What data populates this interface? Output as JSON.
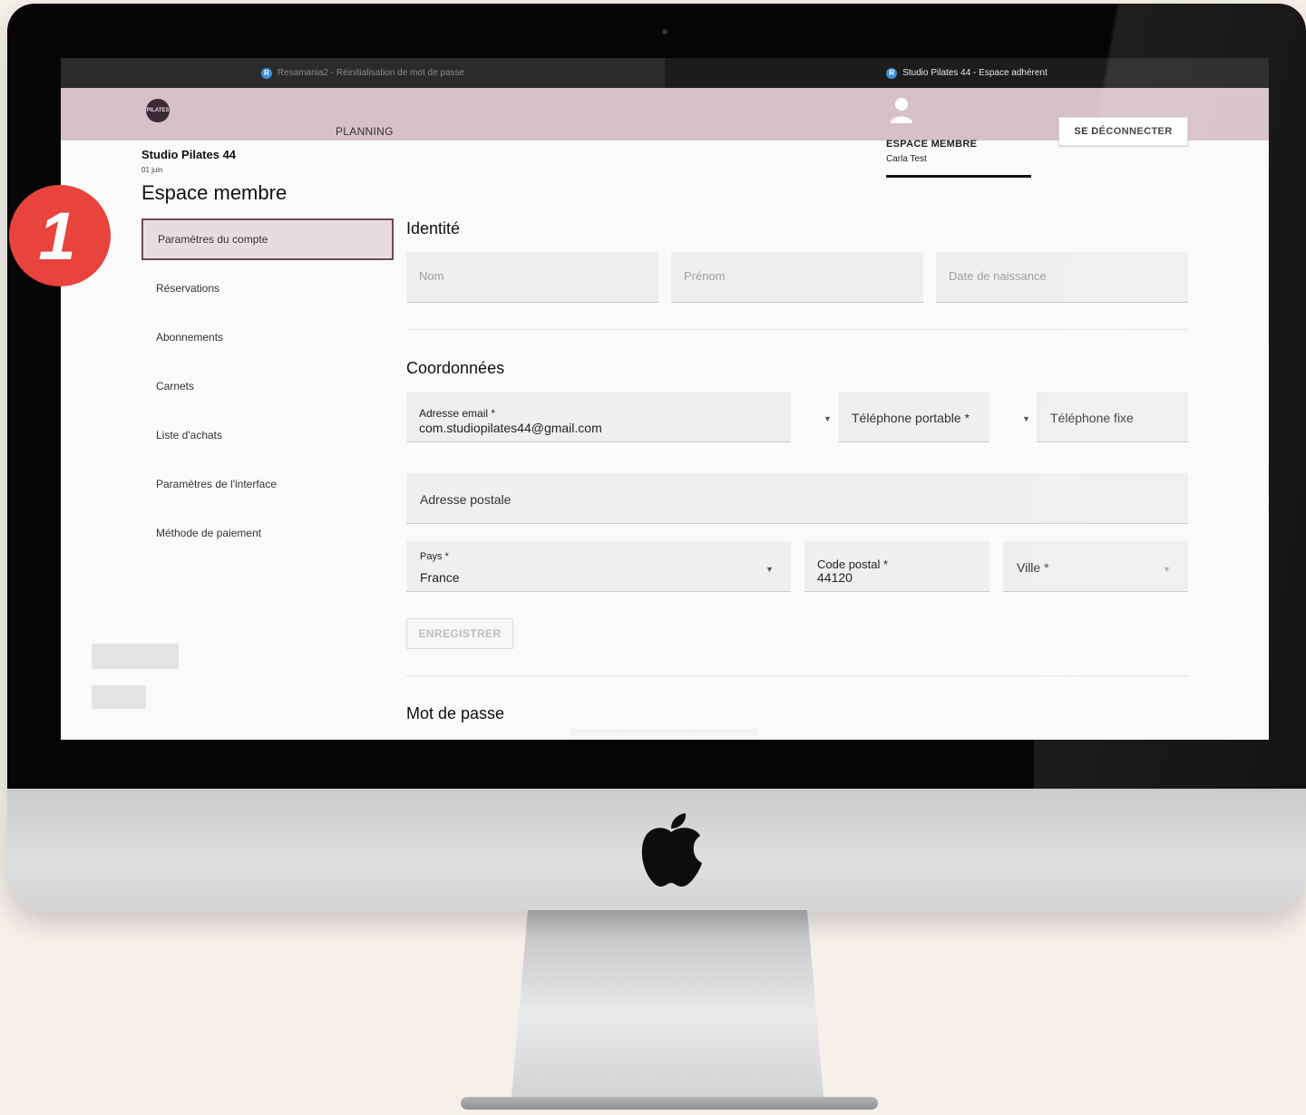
{
  "browser": {
    "tabs": [
      {
        "label": "Resamania2 - Réinitialisation de mot de passe",
        "active": false
      },
      {
        "label": "Studio Pilates 44 - Espace adhérent",
        "active": true
      }
    ]
  },
  "header": {
    "logo_text": "PILATES",
    "nav_planning": "PLANNING",
    "espace_label": "ESPACE MEMBRE",
    "member_name": "Carla Test",
    "logout_label": "SE DÉCONNECTER",
    "band_color": "#d8c0c8"
  },
  "studio": {
    "name": "Studio Pilates 44",
    "date": "01 juin",
    "page_title": "Espace membre"
  },
  "sidebar": {
    "items": [
      {
        "label": "Paramètres du compte",
        "active": true
      },
      {
        "label": "Réservations",
        "active": false
      },
      {
        "label": "Abonnements",
        "active": false
      },
      {
        "label": "Carnets",
        "active": false
      },
      {
        "label": "Liste d'achats",
        "active": false
      },
      {
        "label": "Paramètres de l'interface",
        "active": false
      },
      {
        "label": "Méthode de paiement",
        "active": false
      }
    ]
  },
  "identite": {
    "title": "Identité",
    "nom_placeholder": "Nom",
    "prenom_placeholder": "Prénom",
    "naissance_placeholder": "Date de naissance"
  },
  "coordonnees": {
    "title": "Coordonnées",
    "email_label": "Adresse email *",
    "email_value": "com.studiopilates44@gmail.com",
    "mobile_label": "Téléphone portable *",
    "fixe_label": "Téléphone fixe",
    "adresse_label": "Adresse postale",
    "pays_label": "Pays *",
    "pays_value": "France",
    "cp_label": "Code postal *",
    "cp_value": "44120",
    "ville_label": "Ville *",
    "save_label": "ENREGISTRER"
  },
  "mot_de_passe": {
    "title": "Mot de passe"
  },
  "step_badge": {
    "number": "1",
    "color": "#e8433d"
  }
}
